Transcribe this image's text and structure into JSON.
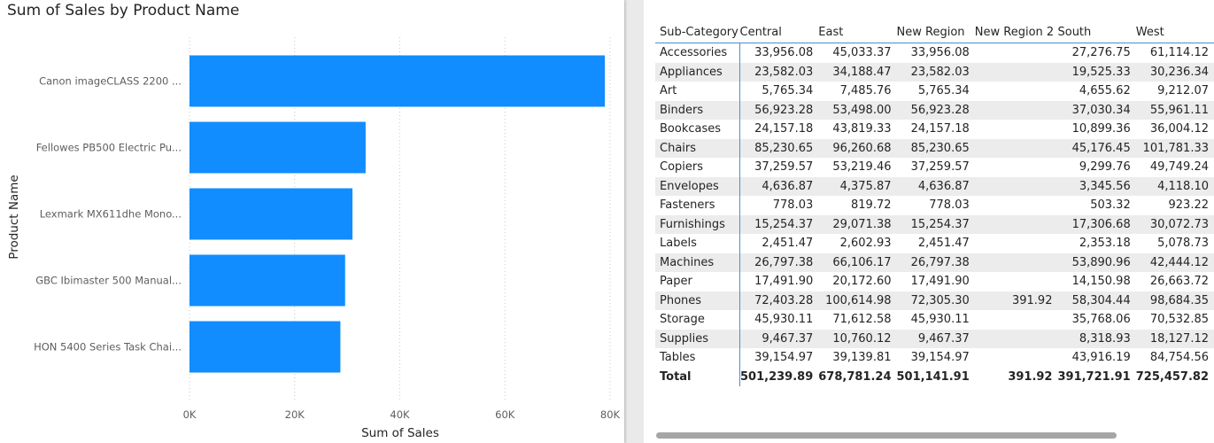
{
  "chart_panel": {
    "title": "Sum of Sales by Product Name"
  },
  "chart_data": {
    "type": "bar",
    "orientation": "horizontal",
    "title": "Sum of Sales by Product Name",
    "xlabel": "Sum of Sales",
    "ylabel": "Product Name",
    "categories": [
      "Canon imageCLASS 2200 ...",
      "Fellowes PB500 Electric Pu...",
      "Lexmark MX611dhe Mono...",
      "GBC Ibimaster 500 Manual...",
      "HON 5400 Series Task Chai..."
    ],
    "values": [
      79000,
      33500,
      31000,
      29600,
      28700
    ],
    "xlim": [
      0,
      80000
    ],
    "xticks": [
      0,
      20000,
      40000,
      60000,
      80000
    ],
    "xtick_labels": [
      "0K",
      "20K",
      "40K",
      "60K",
      "80K"
    ],
    "bar_color": "#118DFF",
    "grid": true
  },
  "table": {
    "headers": [
      "Sub-Category",
      "Central",
      "East",
      "New Region",
      "New Region 2",
      "South",
      "West"
    ],
    "rows": [
      [
        "Accessories",
        "33,956.08",
        "45,033.37",
        "33,956.08",
        "",
        "27,276.75",
        "61,114.12"
      ],
      [
        "Appliances",
        "23,582.03",
        "34,188.47",
        "23,582.03",
        "",
        "19,525.33",
        "30,236.34"
      ],
      [
        "Art",
        "5,765.34",
        "7,485.76",
        "5,765.34",
        "",
        "4,655.62",
        "9,212.07"
      ],
      [
        "Binders",
        "56,923.28",
        "53,498.00",
        "56,923.28",
        "",
        "37,030.34",
        "55,961.11"
      ],
      [
        "Bookcases",
        "24,157.18",
        "43,819.33",
        "24,157.18",
        "",
        "10,899.36",
        "36,004.12"
      ],
      [
        "Chairs",
        "85,230.65",
        "96,260.68",
        "85,230.65",
        "",
        "45,176.45",
        "101,781.33"
      ],
      [
        "Copiers",
        "37,259.57",
        "53,219.46",
        "37,259.57",
        "",
        "9,299.76",
        "49,749.24"
      ],
      [
        "Envelopes",
        "4,636.87",
        "4,375.87",
        "4,636.87",
        "",
        "3,345.56",
        "4,118.10"
      ],
      [
        "Fasteners",
        "778.03",
        "819.72",
        "778.03",
        "",
        "503.32",
        "923.22"
      ],
      [
        "Furnishings",
        "15,254.37",
        "29,071.38",
        "15,254.37",
        "",
        "17,306.68",
        "30,072.73"
      ],
      [
        "Labels",
        "2,451.47",
        "2,602.93",
        "2,451.47",
        "",
        "2,353.18",
        "5,078.73"
      ],
      [
        "Machines",
        "26,797.38",
        "66,106.17",
        "26,797.38",
        "",
        "53,890.96",
        "42,444.12"
      ],
      [
        "Paper",
        "17,491.90",
        "20,172.60",
        "17,491.90",
        "",
        "14,150.98",
        "26,663.72"
      ],
      [
        "Phones",
        "72,403.28",
        "100,614.98",
        "72,305.30",
        "391.92",
        "58,304.44",
        "98,684.35"
      ],
      [
        "Storage",
        "45,930.11",
        "71,612.58",
        "45,930.11",
        "",
        "35,768.06",
        "70,532.85"
      ],
      [
        "Supplies",
        "9,467.37",
        "10,760.12",
        "9,467.37",
        "",
        "8,318.93",
        "18,127.12"
      ],
      [
        "Tables",
        "39,154.97",
        "39,139.81",
        "39,154.97",
        "",
        "43,916.19",
        "84,754.56"
      ]
    ],
    "total": [
      "Total",
      "501,239.89",
      "678,781.24",
      "501,141.91",
      "391.92",
      "391,721.91",
      "725,457.82"
    ]
  }
}
